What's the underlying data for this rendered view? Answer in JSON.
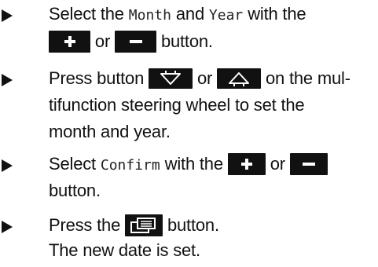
{
  "steps": [
    {
      "l1_a": "Select the",
      "l1_month": "Month",
      "l1_and": "and",
      "l1_year": "Year",
      "l1_b": "with the",
      "l2_or": "or",
      "l2_b": "button."
    },
    {
      "l1_a": "Press button",
      "l1_or": "or",
      "l1_b": "on the mul-",
      "l2": "tifunction steering wheel to set the",
      "l3": "month and year."
    },
    {
      "l1_a": "Select",
      "l1_confirm": "Confirm",
      "l1_b": "with the",
      "l1_or": "or",
      "l2": "button."
    },
    {
      "l1_a": "Press the",
      "l1_b": "button."
    }
  ],
  "result": "The new date is set.",
  "icons": {
    "bullet": "triangle-right-icon",
    "plus": "plus-button-icon",
    "minus": "minus-button-icon",
    "down": "down-arrow-button-icon",
    "up": "up-arrow-button-icon",
    "back": "back-button-icon"
  },
  "colors": {
    "text": "#111111",
    "button": "#111111",
    "button_symbol": "#ffffff"
  }
}
